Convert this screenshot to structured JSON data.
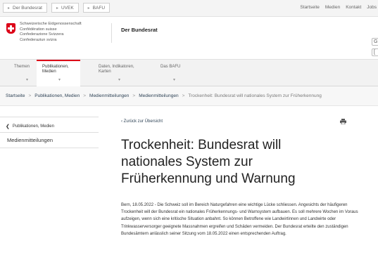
{
  "topbar": {
    "crumbs": [
      "Der Bundesrat",
      "UVEK",
      "BAFU"
    ],
    "links": [
      "Startseite",
      "Medien",
      "Kontakt",
      "Jobs"
    ]
  },
  "header": {
    "federation_names": [
      "Schweizerische Eidgenossenschaft",
      "Confédération suisse",
      "Confederazione Svizzera",
      "Confederaziun svizra"
    ],
    "title": "Der Bundesrat",
    "button_a": "G",
    "button_b": "["
  },
  "nav": {
    "items": [
      {
        "label": "Themen",
        "active": false
      },
      {
        "label": "Publikationen, Medien",
        "active": true
      },
      {
        "label": "Daten, Indikatoren, Karten",
        "active": false
      },
      {
        "label": "Das BAFU",
        "active": false
      }
    ]
  },
  "breadcrumb": {
    "items": [
      "Startseite",
      "Publikationen, Medien",
      "Medienmitteilungen",
      "Medienmitteilungen",
      "Trockenheit: Bundesrat will nationales System zur Früherkennung"
    ],
    "separator": ">"
  },
  "sidebar": {
    "back_label": "Publikationen, Medien",
    "selected": "Medienmitteilungen"
  },
  "content": {
    "back_link": "‹ Zurück zur Übersicht",
    "headline": "Trockenheit: Bundesrat will nationales System zur Früherkennung und Warnung",
    "body": "Bern, 18.05.2022 - Die Schweiz soll im Bereich Naturgefahren eine wichtige Lücke schliessen. Angesichts der häufigeren Trockenheit will der Bundesrat ein nationales Früherkennungs- und Warnsystem aufbauen. Es soll mehrere Wochen im Voraus aufzeigen, wenn sich eine kritische Situation anbahnt. So können Betroffene wie Landwirtinnen und Landwirte oder Trinkwasserversorger geeignete Massnahmen ergreifen und Schäden vermeiden. Der Bundesrat erteilte den zuständigen Bundesämtern anlässlich seiner Sitzung vom 18.05.2022 einen entsprechenden Auftrag."
  },
  "colors": {
    "accent_red": "#dc0018",
    "link_blue": "#2f4356"
  }
}
